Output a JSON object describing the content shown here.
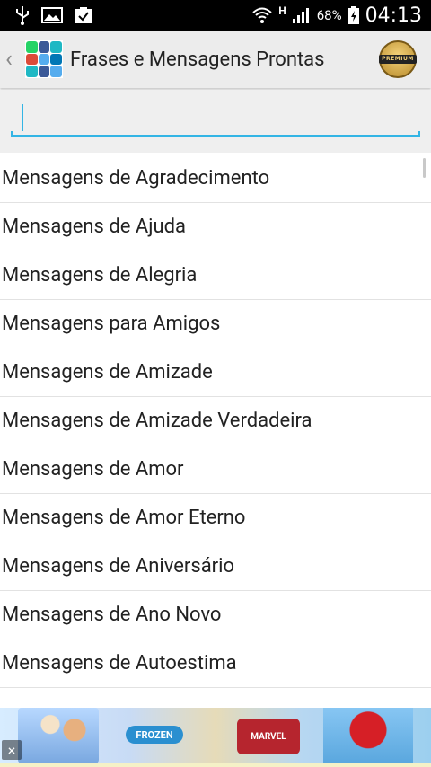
{
  "status_bar": {
    "network_type": "H",
    "battery_percent": "68%",
    "time": "04:13",
    "icons": [
      "usb-icon",
      "image-icon",
      "clipboard-check-icon",
      "wifi-icon",
      "signal-icon",
      "battery-charging-icon"
    ]
  },
  "action_bar": {
    "title": "Frases e Mensagens Prontas",
    "premium_label": "PREMIUM",
    "up_icon": "chevron-left-icon"
  },
  "search": {
    "value": "",
    "placeholder": ""
  },
  "list": {
    "items": [
      "Mensagens de Agradecimento",
      "Mensagens de Ajuda",
      "Mensagens de Alegria",
      "Mensagens para Amigos",
      "Mensagens de Amizade",
      "Mensagens de Amizade Verdadeira",
      "Mensagens de Amor",
      "Mensagens de Amor Eterno",
      "Mensagens de Aniversário",
      "Mensagens de Ano Novo",
      "Mensagens de Autoestima"
    ]
  },
  "ad": {
    "frozen_label": "FROZEN",
    "marvel_label": "MARVEL",
    "close_symbol": "×"
  },
  "colors": {
    "accent": "#33b5e5",
    "action_bar_bg": "#ececec",
    "status_bar_bg": "#000000"
  }
}
